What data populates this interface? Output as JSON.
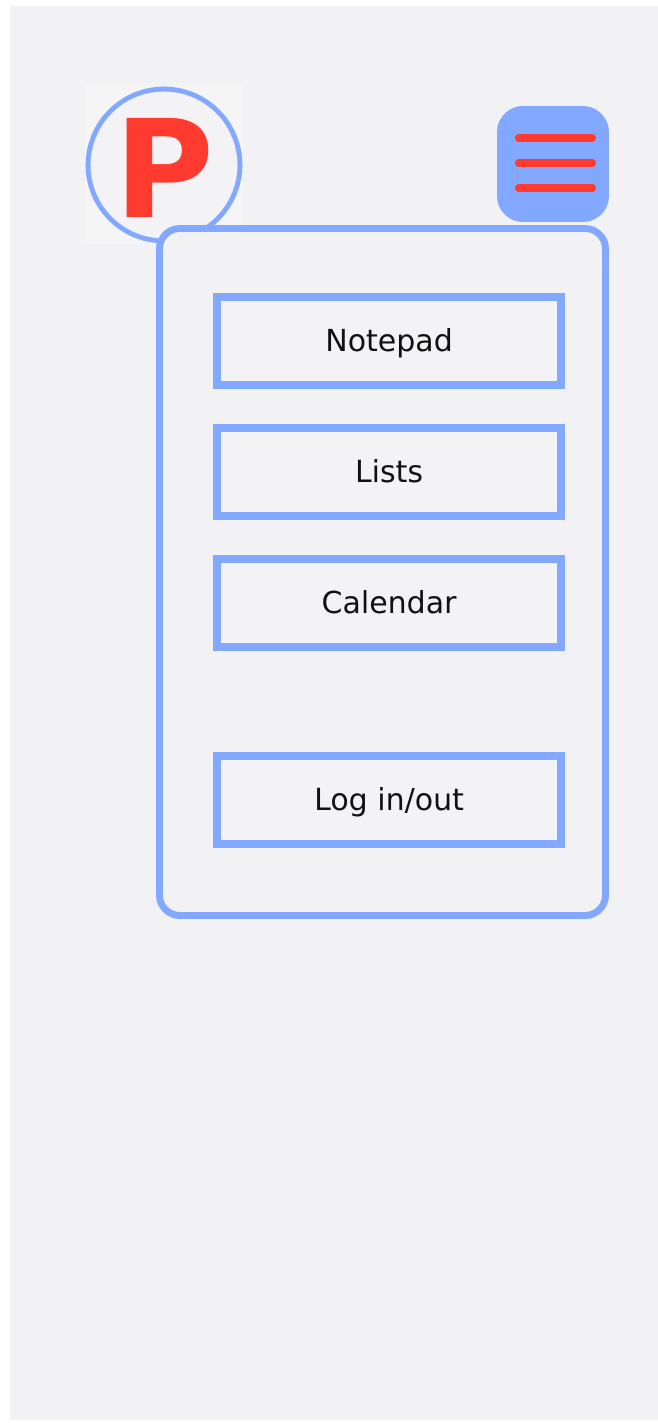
{
  "header": {
    "logo_letter": "P",
    "logo_icon": "p-logo-icon",
    "menu_icon": "hamburger-menu-icon"
  },
  "menu": {
    "items": [
      {
        "label": "Notepad"
      },
      {
        "label": "Lists"
      },
      {
        "label": "Calendar"
      },
      {
        "label": "Log in/out"
      }
    ]
  },
  "colors": {
    "accent_blue": "#82a8ff",
    "logo_red": "#ff3b30",
    "background": "#f2f2f4"
  }
}
